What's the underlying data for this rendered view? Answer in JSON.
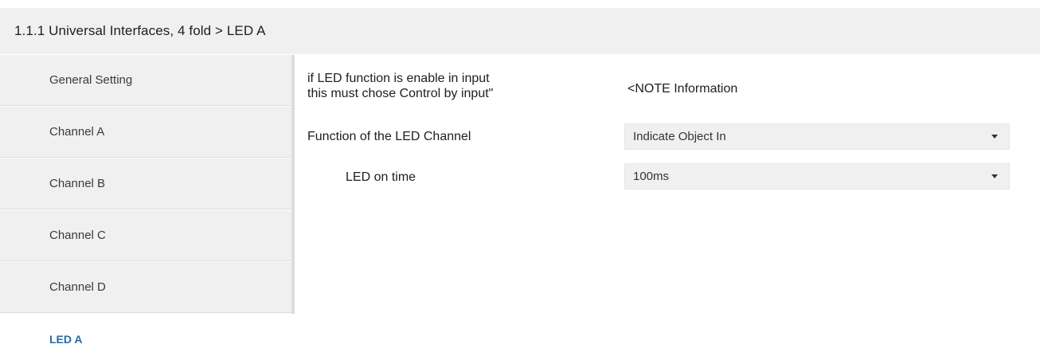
{
  "header": {
    "title": "1.1.1 Universal Interfaces, 4 fold > LED A"
  },
  "sidebar": {
    "items": [
      {
        "label": "General Setting",
        "active": false
      },
      {
        "label": "Channel A",
        "active": false
      },
      {
        "label": "Channel B",
        "active": false
      },
      {
        "label": "Channel C",
        "active": false
      },
      {
        "label": "Channel D",
        "active": false
      },
      {
        "label": "LED A",
        "active": true
      }
    ]
  },
  "params": {
    "note": {
      "label_line1": "if LED function is enable in input",
      "label_line2": "this must chose Control by input\"",
      "value": "<NOTE Information"
    },
    "function": {
      "label": "Function of the LED Channel",
      "value": "Indicate Object In"
    },
    "on_time": {
      "label": "LED on time",
      "value": "100ms"
    }
  },
  "colors": {
    "header_bg": "#f0f0f0",
    "sidebar_bg": "#f0f0f0",
    "active_item": "#2a6aa8",
    "dropdown_bg": "#f0f0f0"
  },
  "icons": {
    "dropdown": "chevron-down-icon"
  }
}
